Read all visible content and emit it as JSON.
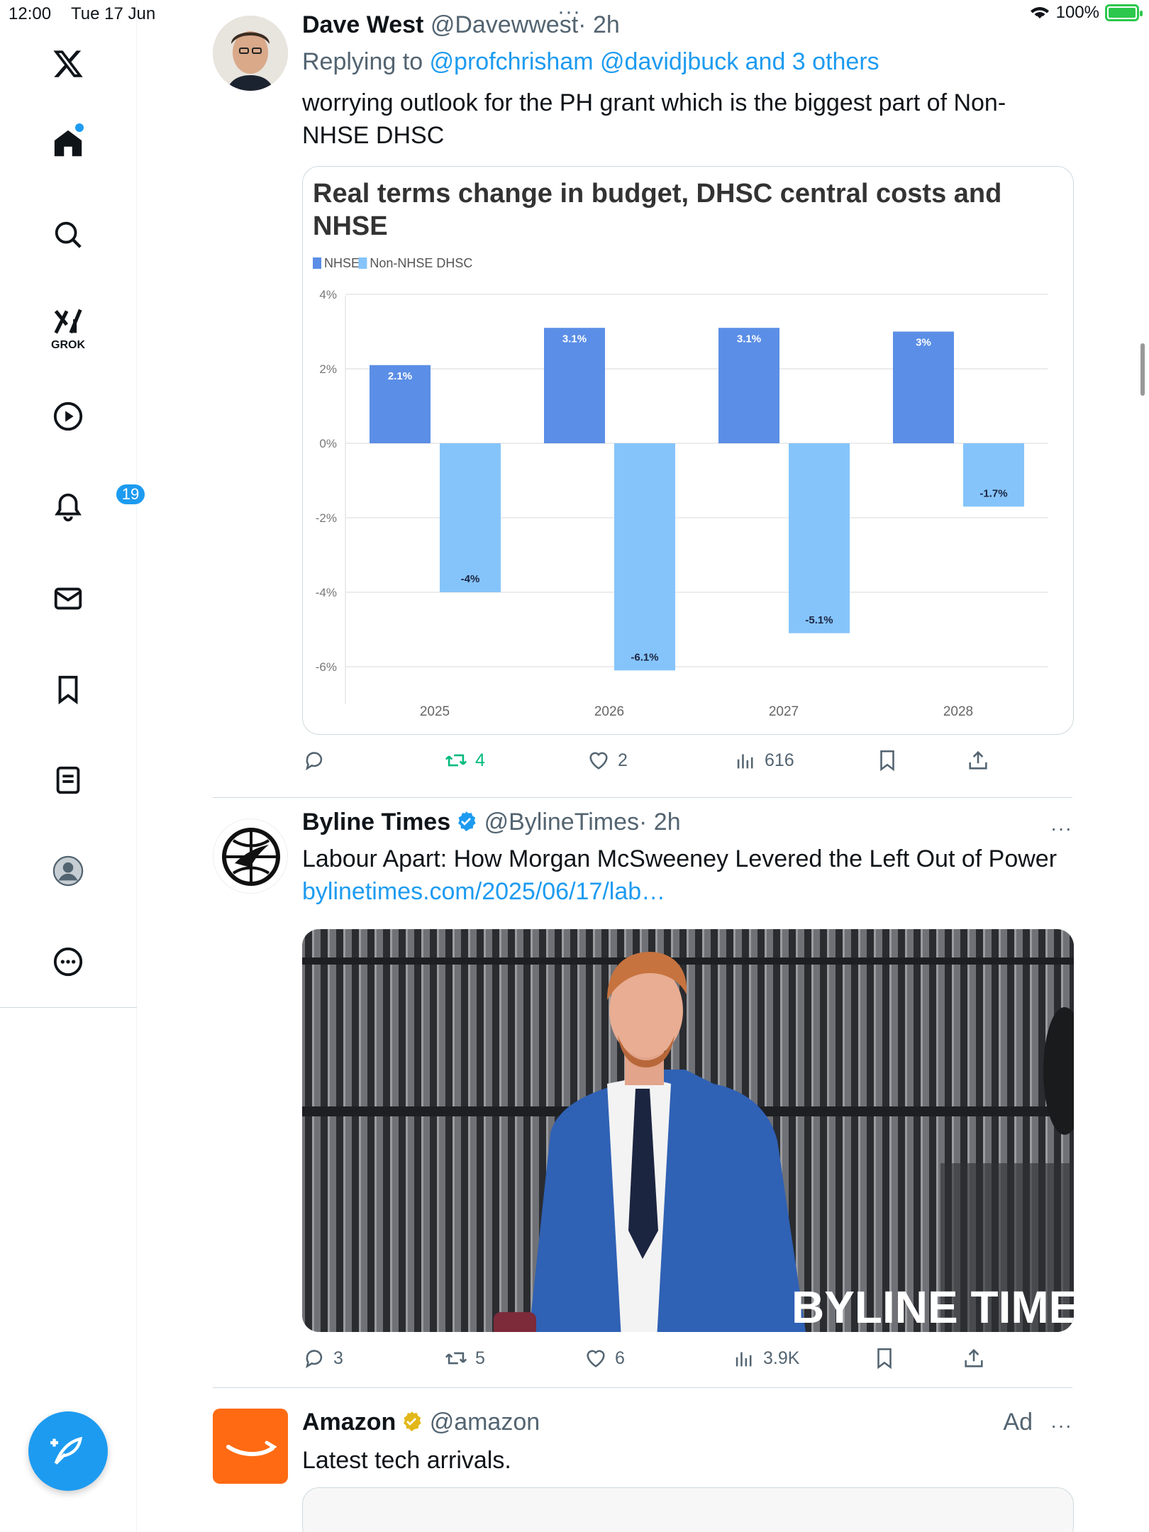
{
  "status_bar": {
    "time": "12:00",
    "date": "Tue 17 Jun",
    "battery": "100%"
  },
  "sidebar": {
    "grok_label": "GROK",
    "notifications_badge": "19"
  },
  "posts": [
    {
      "name": "Dave West",
      "handle": "@Davewwest",
      "time": "· 2h",
      "replying_prefix": "Replying to ",
      "replying_to": "@profchrisham @davidjbuck and 3 others",
      "text": "worrying outlook for the PH grant which is the biggest part of Non-NHSE DHSC",
      "actions": {
        "replies": "",
        "reposts": "4",
        "likes": "2",
        "views": "616"
      }
    },
    {
      "name": "Byline Times",
      "handle": "@BylineTimes",
      "time": "· 2h",
      "text": "Labour Apart: How Morgan McSweeney Levered the Left Out of Power",
      "link": "bylinetimes.com/2025/06/17/lab…",
      "image_watermark": "BYLINE TIMES",
      "actions": {
        "replies": "3",
        "reposts": "5",
        "likes": "6",
        "views": "3.9K"
      }
    },
    {
      "name": "Amazon",
      "handle": "@amazon",
      "ad_label": "Ad",
      "text": "Latest tech arrivals."
    }
  ],
  "more_dots": "···",
  "colors": {
    "accent": "#1d9bf0",
    "repost_active": "#00ba7c",
    "nhse": "#5b8ee6",
    "non_nhse": "#85c4fb",
    "amazon": "#ff6a13",
    "verified_gold": "#e2b719"
  },
  "chart_data": {
    "type": "bar",
    "title": "Real terms change in budget, DHSC central costs and NHSE",
    "categories": [
      "2025",
      "2026",
      "2027",
      "2028"
    ],
    "series": [
      {
        "name": "NHSE",
        "values": [
          2.1,
          3.1,
          3.1,
          3.0
        ],
        "labels": [
          "2.1%",
          "3.1%",
          "3.1%",
          "3%"
        ]
      },
      {
        "name": "Non-NHSE DHSC",
        "values": [
          -4.0,
          -6.1,
          -5.1,
          -1.7
        ],
        "labels": [
          "-4%",
          "-6.1%",
          "-5.1%",
          "-1.7%"
        ]
      }
    ],
    "yticks": [
      "4%",
      "2%",
      "0%",
      "-2%",
      "-4%",
      "-6%"
    ],
    "ytick_values": [
      4,
      2,
      0,
      -2,
      -4,
      -6
    ],
    "ylim": [
      -7,
      4
    ],
    "legend": "top-left",
    "grid": true
  }
}
